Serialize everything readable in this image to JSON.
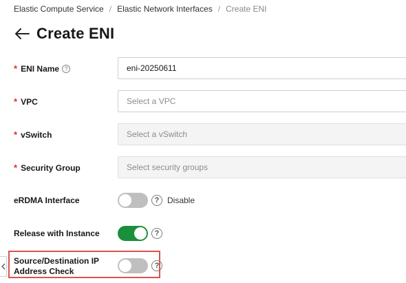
{
  "breadcrumb": {
    "items": [
      "Elastic Compute Service",
      "Elastic Network Interfaces"
    ],
    "separator": "/",
    "current": "Create ENI"
  },
  "page_title": "Create ENI",
  "icons": {
    "back": "arrow-left-icon",
    "help": "question-circle-icon",
    "collapse": "chevron-left-icon"
  },
  "colors": {
    "required": "#d93026",
    "switch_on": "#1a8f3c",
    "switch_off": "#bfbfbf",
    "highlight": "#d9534f"
  },
  "form": {
    "required_mark": "*",
    "help_mark": "?",
    "eni_name": {
      "label": "ENI Name",
      "value": "eni-20250611"
    },
    "vpc": {
      "label": "VPC",
      "placeholder": "Select a VPC"
    },
    "vswitch": {
      "label": "vSwitch",
      "placeholder": "Select a vSwitch",
      "disabled": true
    },
    "security_group": {
      "label": "Security Group",
      "placeholder": "Select security groups",
      "disabled": true
    },
    "erdma": {
      "label": "eRDMA Interface",
      "enabled": false,
      "status_text": "Disable"
    },
    "release_with_instance": {
      "label": "Release with Instance",
      "enabled": true
    },
    "src_dst_check": {
      "label_line1": "Source/Destination IP",
      "label_line2": "Address Check",
      "enabled": false
    }
  }
}
